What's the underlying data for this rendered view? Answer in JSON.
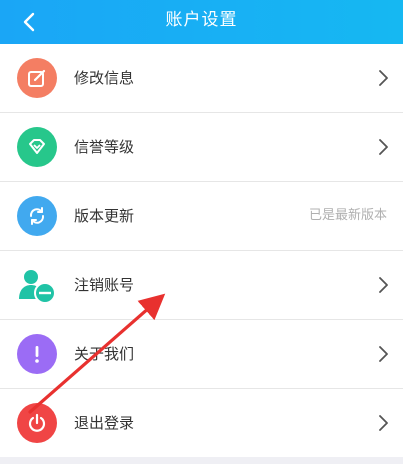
{
  "header": {
    "title": "账户设置",
    "back_icon": "chevron-left-icon",
    "bg_color": "#1aa6f6"
  },
  "items": [
    {
      "label": "修改信息",
      "icon": "edit-icon",
      "color": "#f47e63"
    },
    {
      "label": "信誉等级",
      "icon": "diamond-icon",
      "color": "#27c78b"
    },
    {
      "label": "版本更新",
      "icon": "refresh-icon",
      "color": "#41a9ef",
      "status": "已是最新版本"
    },
    {
      "label": "注销账号",
      "icon": "user-minus-icon",
      "color": "#20c3a6"
    },
    {
      "label": "关于我们",
      "icon": "info-icon",
      "color": "#9b6cf5"
    },
    {
      "label": "退出登录",
      "icon": "power-icon",
      "color": "#f04545"
    }
  ],
  "annotation": {
    "type": "red-arrow",
    "color": "#e8312f"
  }
}
